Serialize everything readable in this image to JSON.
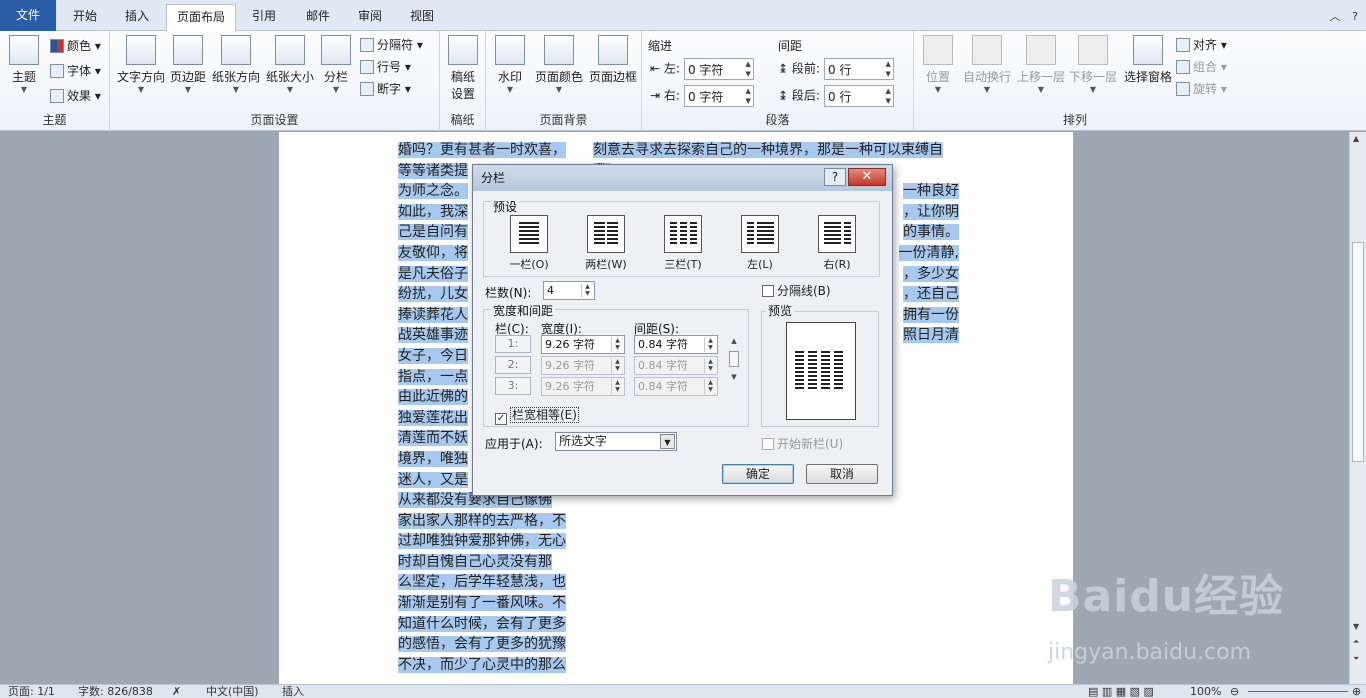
{
  "tabs": [
    "文件",
    "开始",
    "插入",
    "页面布局",
    "引用",
    "邮件",
    "审阅",
    "视图"
  ],
  "ribbon": {
    "theme": {
      "label": "主题",
      "colors": "颜色",
      "fonts": "字体",
      "effects": "效果",
      "group": "主题"
    },
    "page_setup": {
      "text_dir": "文字方向",
      "margins": "页边距",
      "orientation": "纸张方向",
      "size": "纸张大小",
      "columns": "分栏",
      "breaks": "分隔符",
      "line_numbers": "行号",
      "hyphenation": "断字",
      "group": "页面设置"
    },
    "draft": {
      "label1": "稿纸",
      "label2": "设置",
      "group": "稿纸"
    },
    "background": {
      "watermark": "水印",
      "page_color": "页面颜色",
      "page_border": "页面边框",
      "group": "页面背景"
    },
    "paragraph": {
      "indent": "缩进",
      "left": "左:",
      "left_val": "0 字符",
      "right": "右:",
      "right_val": "0 字符",
      "spacing": "间距",
      "before": "段前:",
      "before_val": "0 行",
      "after": "段后:",
      "after_val": "0 行",
      "group": "段落"
    },
    "arrange": {
      "position": "位置",
      "wrap": "自动换行",
      "forward": "上移一层",
      "backward": "下移一层",
      "pane": "选择窗格",
      "align": "对齐",
      "group_obj": "组合",
      "rotate": "旋转",
      "group": "排列"
    }
  },
  "doc": {
    "col1": [
      "婚吗？更有甚者一时欢喜，",
      "等等诸类提",
      "为师之念。",
      "如此，我深",
      "己是自问有",
      "友敬仰，将",
      "是凡夫俗子",
      "纷扰，儿女",
      "捧读葬花人",
      "战英雄事迹",
      "女子，今日",
      "指点，一点",
      "由此近佛的",
      "独爱莲花出",
      "清莲而不妖",
      "境界，唯独",
      "迷人，又是",
      "从来都没有要求自己像佛",
      "家出家人那样的去严格，不",
      "过却唯独钟爱那钟佛，无心",
      "时却自愧自己心灵没有那",
      "么坚定，后学年轻慧浅，也",
      "渐渐是别有了一番风味。不",
      "知道什么时候，会有了更多",
      "的感悟，会有了更多的犹豫",
      "不决，而少了心灵中的那么"
    ],
    "col2": [
      "刻意去寻求去探索自己的一种境界，那是一种可以束缚自我,",
      "一种良好",
      "，让你明",
      "的事情。",
      "一份清静,",
      "，多少女",
      "，还自己",
      "拥有一份",
      "照日月清"
    ]
  },
  "dialog": {
    "title": "分栏",
    "help": "?",
    "close": "✕",
    "presets_label": "预设",
    "presets": [
      "一栏(O)",
      "两栏(W)",
      "三栏(T)",
      "左(L)",
      "右(R)"
    ],
    "num_cols_label": "栏数(N):",
    "num_cols": "4",
    "separator": "分隔线(B)",
    "width_spacing": "宽度和间距",
    "preview_label": "预览",
    "col_hdr": "栏(C):",
    "width_hdr": "宽度(I):",
    "spacing_hdr": "间距(S):",
    "rows": [
      {
        "n": "1:",
        "w": "9.26 字符",
        "s": "0.84 字符"
      },
      {
        "n": "2:",
        "w": "9.26 字符",
        "s": "0.84 字符"
      },
      {
        "n": "3:",
        "w": "9.26 字符",
        "s": "0.84 字符"
      }
    ],
    "equal_width": "栏宽相等(E)",
    "apply_label": "应用于(A):",
    "apply_value": "所选文字",
    "new_col": "开始新栏(U)",
    "ok": "确定",
    "cancel": "取消"
  },
  "status": {
    "page": "页面: 1/1",
    "words": "字数: 826/838",
    "lang": "中文(中国)",
    "mode": "插入",
    "zoom": "100%"
  },
  "watermark": {
    "brand": "Baidu经验",
    "url": "jingyan.baidu.com"
  }
}
